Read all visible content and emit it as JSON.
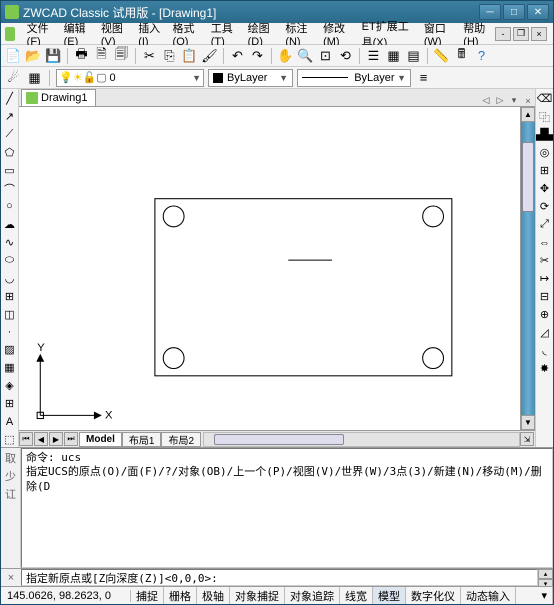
{
  "title": "ZWCAD Classic 试用版 - [Drawing1]",
  "menus": [
    "文件(F)",
    "编辑(E)",
    "视图(V)",
    "插入(I)",
    "格式(O)",
    "工具(T)",
    "绘图(D)",
    "标注(N)",
    "修改(M)",
    "ET扩展工具(X)",
    "窗口(W)",
    "帮助(H)"
  ],
  "doc_tab": "Drawing1",
  "layer_text": "0",
  "bylayer": "ByLayer",
  "bylayer2": "ByLayer",
  "layout": {
    "model": "Model",
    "l1": "布局1",
    "l2": "布局2"
  },
  "cmd_history": "命令: ucs\n指定UCS的原点(O)/面(F)/?/对象(OB)/上一个(P)/视图(V)/世界(W)/3点(3)/新建(N)/移动(M)/删除(D",
  "cmd_prompt": "指定新原点或[Z向深度(Z)]<0,0,0>:",
  "coords": "145.0626,  98.2623,  0",
  "status": [
    "捕捉",
    "栅格",
    "极轴",
    "对象捕捉",
    "对象追踪",
    "线宽",
    "模型",
    "数字化仪",
    "动态输入"
  ],
  "axis": {
    "x": "X",
    "y": "Y"
  }
}
